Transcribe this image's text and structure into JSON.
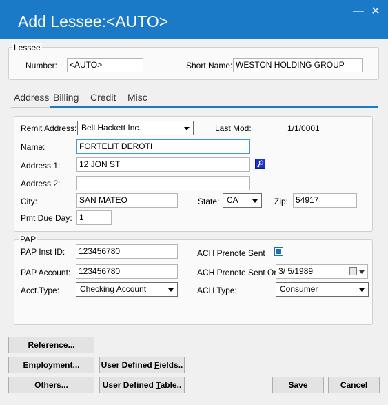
{
  "window": {
    "title": "Add Lessee:<AUTO>",
    "minimize": "—",
    "close": "✕"
  },
  "lessee": {
    "legend": "Lessee",
    "number_label": "Number:",
    "number_value": "<AUTO>",
    "short_name_label": "Short Name:",
    "short_name_value": "WESTON HOLDING GROUP"
  },
  "tabs": [
    {
      "label": "Address"
    },
    {
      "label": "Billing"
    },
    {
      "label": "Credit"
    },
    {
      "label": "Misc"
    }
  ],
  "active_tab": "Billing",
  "billing": {
    "remit_label": "Remit Address:",
    "remit_value": "Bell Hackett Inc.",
    "last_mod_label": "Last Mod:",
    "last_mod_value": "1/1/0001",
    "name_label": "Name:",
    "name_value": "FORTELIT DEROTI",
    "address1_label": "Address 1:",
    "address1_value": "12 JON ST",
    "address2_label": "Address 2:",
    "address2_value": "",
    "city_label": "City:",
    "city_value": "SAN MATEO",
    "state_label": "State:",
    "state_value": "CA",
    "zip_label": "Zip:",
    "zip_value": "54917",
    "pmt_label": "Pmt Due Day:",
    "pmt_value": "1"
  },
  "pap": {
    "legend": "PAP",
    "inst_label": "PAP Inst ID:",
    "inst_value": "123456780",
    "account_label": "PAP Account:",
    "account_value": "123456780",
    "acct_type_label": "Acct.Type:",
    "acct_type_value": "Checking Account",
    "prenote_sent_label_pre": "AC",
    "prenote_sent_label_u": "H",
    "prenote_sent_label_post": " Prenote Sent",
    "prenote_sent_checked": true,
    "prenote_on_label": "ACH Prenote Sent On:",
    "prenote_on_value": "3/  5/1989",
    "ach_type_label": "ACH Type:",
    "ach_type_value": "Consumer"
  },
  "buttons": {
    "reference": "Reference...",
    "employment": "Employment...",
    "others": "Others...",
    "udf_pre": "User Defined ",
    "udf_u": "F",
    "udf_post": "ields..",
    "udt_pre": "User Defined ",
    "udt_u": "T",
    "udt_post": "able..",
    "save": "Save",
    "cancel": "Cancel"
  },
  "colors": {
    "titlebar": "#1a7ac7",
    "tab_underline": "#1a7ac7",
    "checkbox": "#1a6fbd"
  }
}
